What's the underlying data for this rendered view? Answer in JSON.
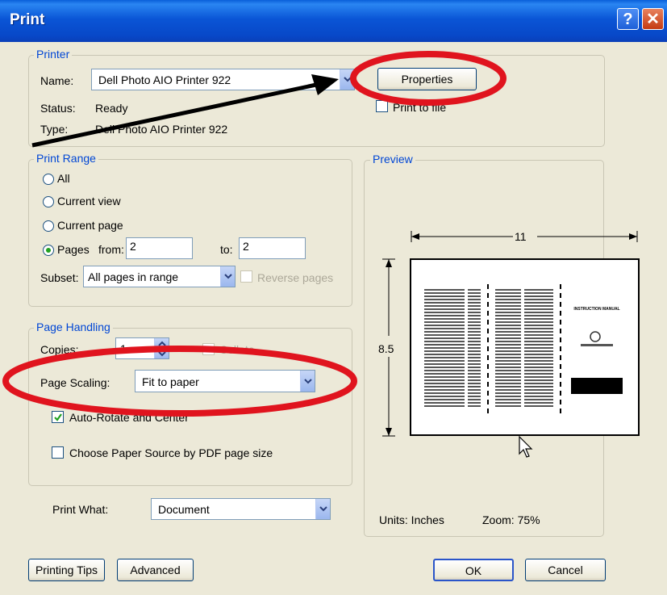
{
  "title": "Print",
  "printer": {
    "legend": "Printer",
    "name_label": "Name:",
    "name_value": "Dell Photo AIO Printer 922",
    "status_label": "Status:",
    "status_value": "Ready",
    "type_label": "Type:",
    "type_value": "Dell Photo AIO Printer 922",
    "properties_label": "Properties",
    "print_to_file_label": "Print to file"
  },
  "range": {
    "legend": "Print Range",
    "all": "All",
    "current_view": "Current view",
    "current_page": "Current page",
    "pages_label": "Pages",
    "from_label": "from:",
    "from_value": "2",
    "to_label": "to:",
    "to_value": "2",
    "subset_label": "Subset:",
    "subset_value": "All pages in range",
    "reverse_label": "Reverse pages",
    "selected": "pages"
  },
  "handling": {
    "legend": "Page Handling",
    "copies_label": "Copies:",
    "copies_value": "1",
    "collate_label": "Collate",
    "scaling_label": "Page Scaling:",
    "scaling_value": "Fit to paper",
    "autorotate_label": "Auto-Rotate and Center",
    "autorotate_checked": true,
    "paper_source_label": "Choose Paper Source by PDF page size",
    "paper_source_checked": false
  },
  "print_what": {
    "label": "Print What:",
    "value": "Document"
  },
  "preview": {
    "legend": "Preview",
    "width_label": "11",
    "height_label": "8.5",
    "units_label": "Units: Inches",
    "zoom_label": "Zoom:  75%",
    "doc_title": "INSTRUCTION MANUAL"
  },
  "buttons": {
    "tips": "Printing Tips",
    "advanced": "Advanced",
    "ok": "OK",
    "cancel": "Cancel"
  },
  "annotation_color": "#e0141e"
}
